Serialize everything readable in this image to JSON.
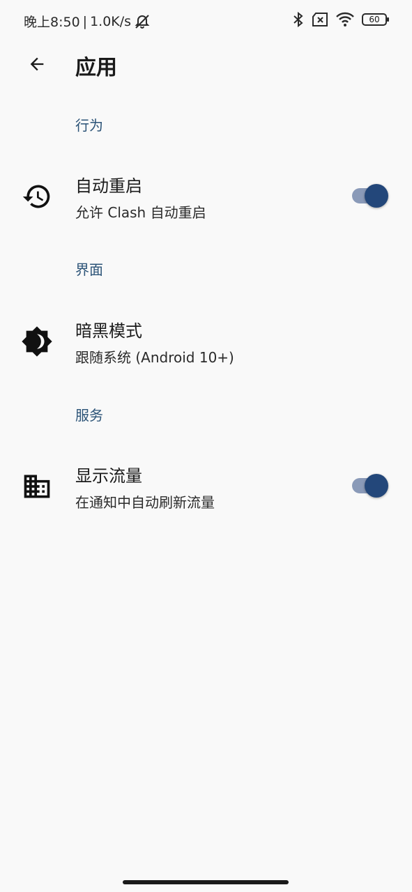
{
  "status_bar": {
    "time": "晚上8:50",
    "speed": "1.0K/s",
    "battery": "60",
    "icons": [
      "alarm-off-icon",
      "bluetooth-icon",
      "sim-x-icon",
      "wifi-icon",
      "battery-icon"
    ]
  },
  "app_bar": {
    "title": "应用",
    "back_icon": "arrow-back-icon"
  },
  "sections": [
    {
      "header": "行为",
      "items": [
        {
          "title": "自动重启",
          "summary": "允许 Clash 自动重启",
          "icon": "restore-history-icon",
          "toggle": true
        }
      ]
    },
    {
      "header": "界面",
      "items": [
        {
          "title": "暗黑模式",
          "summary": "跟随系统 (Android 10+)",
          "icon": "dark-mode-icon"
        }
      ]
    },
    {
      "header": "服务",
      "items": [
        {
          "title": "显示流量",
          "summary": "在通知中自动刷新流量",
          "icon": "building-icon",
          "toggle": true
        }
      ]
    }
  ],
  "colors": {
    "accent": "#23477a",
    "section_header": "#2b5377",
    "switch_track": "#8a9ab8",
    "background": "#f9f9f9"
  }
}
